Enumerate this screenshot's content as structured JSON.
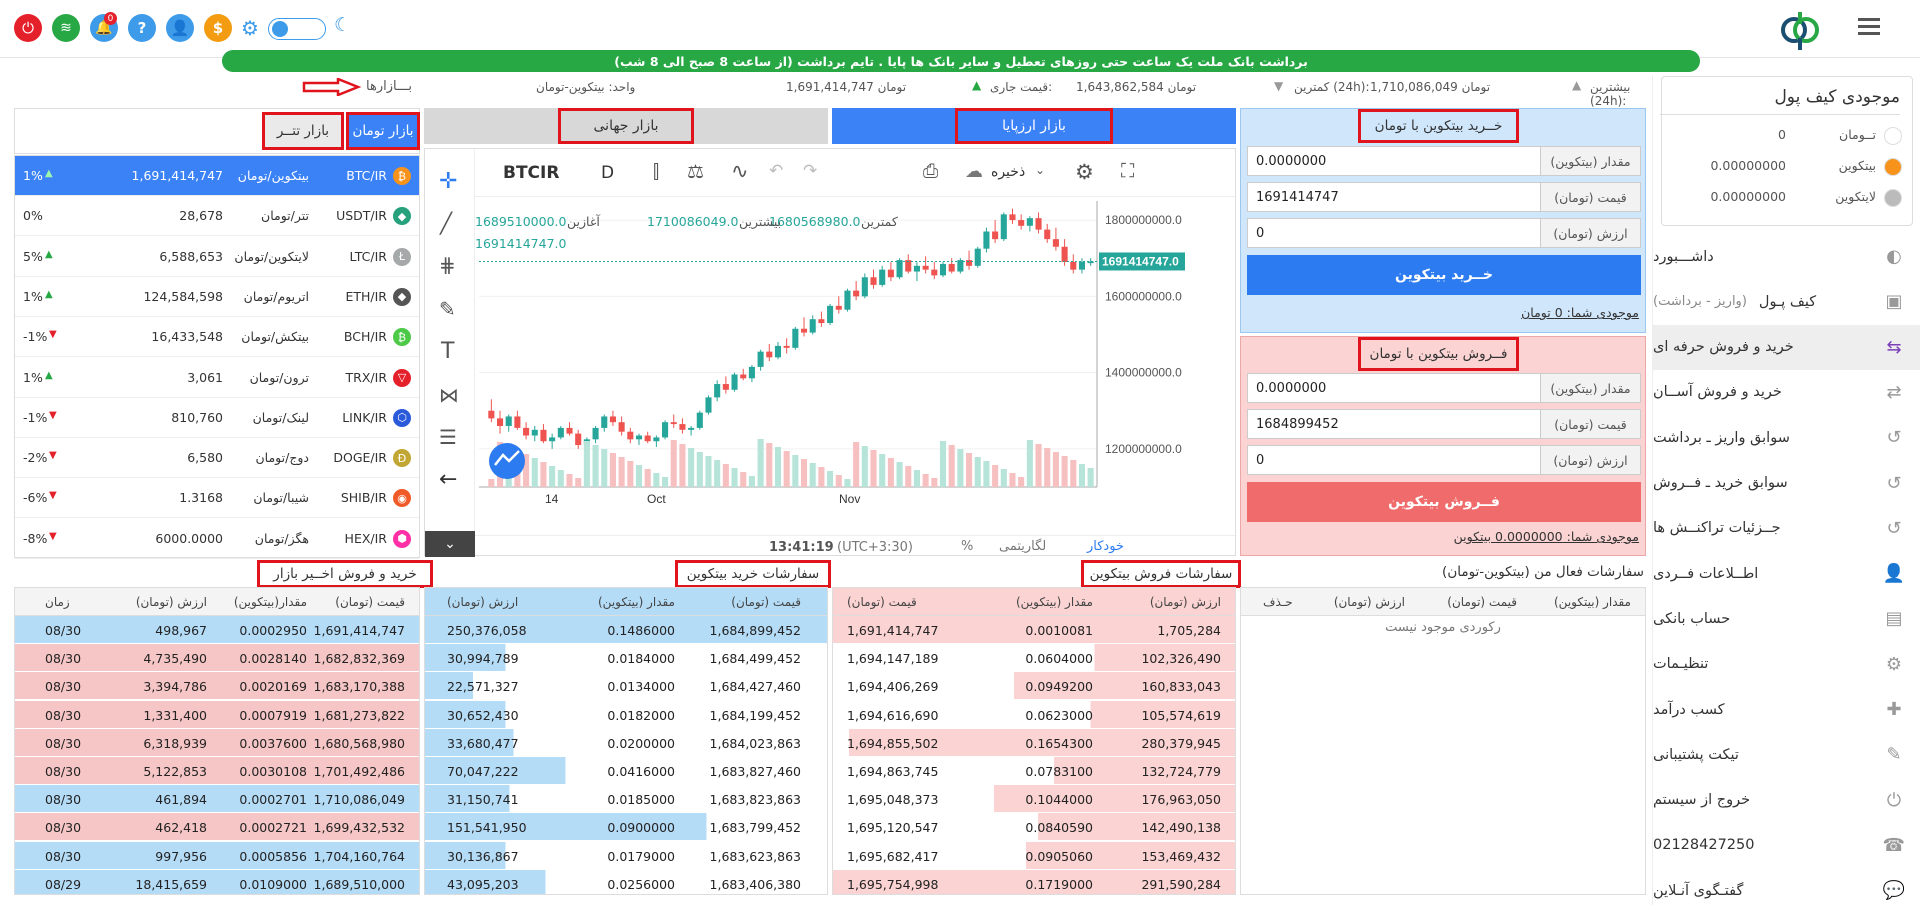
{
  "topbar": {
    "logo": "logo",
    "menu_icon": "menu-icon"
  },
  "banner": {
    "text": "برداشت بانک ملت یک ساعت حتی روزهای تعطیل و سایر بانک ها پایا . تایم برداشت (از ساعت 8 صبح الی 8 شب)"
  },
  "stats": {
    "markets_label": "بـــازارها",
    "unit": "واحد: بیتکوین-تومان",
    "current_label": "قیمت جاری:",
    "current": "1,691,414,747 تومان",
    "low_label": "کمترین (24h):",
    "low": "1,643,862,584 تومان",
    "high_label": "بیشترین (24h):",
    "high": "1,710,086,049 تومان"
  },
  "wallet": {
    "title": "موجودی کیف پول",
    "items": [
      {
        "name": "تــومان",
        "value": "0",
        "color": "#ffffff"
      },
      {
        "name": "بیتکوین",
        "value": "0.00000000",
        "color": "#f7931a"
      },
      {
        "name": "لایتکوین",
        "value": "0.00000000",
        "color": "#bbbbbb"
      }
    ]
  },
  "nav": [
    {
      "label": "داشـــبورد",
      "icon": "dashboard-icon",
      "glyph": "◐"
    },
    {
      "label": "کیف پـول",
      "sub": "(واریز - برداشت)",
      "icon": "wallet-icon",
      "glyph": "▣"
    },
    {
      "label": "خرید و فروش حرفه ای",
      "icon": "trade-pro-icon",
      "glyph": "⇆",
      "active": true
    },
    {
      "label": "خرید و فروش آســان",
      "icon": "trade-easy-icon",
      "glyph": "⇄"
    },
    {
      "label": "سوابق واریز ـ برداشت",
      "icon": "history-icon",
      "glyph": "↺"
    },
    {
      "label": "سوابق خرید ـ فــروش",
      "icon": "history-icon",
      "glyph": "↺"
    },
    {
      "label": "جــزئیات تراکنــش ها",
      "icon": "history-icon",
      "glyph": "↺"
    },
    {
      "label": "اطــلاعات فــردی",
      "icon": "user-icon",
      "glyph": "👤"
    },
    {
      "label": "حساب بانکی",
      "icon": "bank-icon",
      "glyph": "▤"
    },
    {
      "label": "تنظیـمات",
      "icon": "gear-icon",
      "glyph": "⚙"
    },
    {
      "label": "کسب درآمد",
      "icon": "add-user-icon",
      "glyph": "✚"
    },
    {
      "label": "تیکت پشتیبانی",
      "icon": "support-icon",
      "glyph": "✎"
    },
    {
      "label": "خروج از سیستم",
      "icon": "power-icon",
      "glyph": "⏻"
    },
    {
      "label": "02128427250",
      "icon": "headset-icon",
      "glyph": "☎"
    },
    {
      "label": "گفتـگوی آنـلاین",
      "icon": "chat-icon",
      "glyph": "💬"
    }
  ],
  "buy": {
    "title": "خــرید بیتکوین با تومان",
    "amount_label": "مقدار (بیتکوین)",
    "amount": "0.0000000",
    "price_label": "قیمت (تومان)",
    "price": "1691414747",
    "value_label": "ارزش (تومان)",
    "value": "0",
    "button": "خــرید بیتکوین",
    "balance": "موجودی شما: 0 تومان"
  },
  "sell": {
    "title": "فــروش بیتکوین با تومان",
    "amount_label": "مقدار (بیتکوین)",
    "amount": "0.0000000",
    "price_label": "قیمت (تومان)",
    "price": "1684899452",
    "value_label": "ارزش (تومان)",
    "value": "0",
    "button": "فــروش بیتکوین",
    "balance": "موجودی شما: 0.0000000 بیتکوین"
  },
  "market_tabs": {
    "arzpaya": "بازار ارزپایا",
    "global": "بازار جهانی"
  },
  "list_tabs": {
    "toman": "بازار تومان",
    "tether": "بازار تتــر"
  },
  "markets": [
    {
      "symbol": "BTC/IR",
      "name": "بیتکوین/تومان",
      "price": "1,691,414,747",
      "change": "1%",
      "dir": "up",
      "icon": "₿",
      "color": "#f7931a",
      "selected": true
    },
    {
      "symbol": "USDT/IR",
      "name": "تتر/تومان",
      "price": "28,678",
      "change": "0%",
      "dir": "none",
      "icon": "◆",
      "color": "#26a17b"
    },
    {
      "symbol": "LTC/IR",
      "name": "لایتکوین/تومان",
      "price": "6,588,653",
      "change": "5%",
      "dir": "up",
      "icon": "Ł",
      "color": "#a6a9aa"
    },
    {
      "symbol": "ETH/IR",
      "name": "اتریوم/تومان",
      "price": "124,584,598",
      "change": "1%",
      "dir": "up",
      "icon": "◆",
      "color": "#555555"
    },
    {
      "symbol": "BCH/IR",
      "name": "بیتکش/تومان",
      "price": "16,433,548",
      "change": "-1%",
      "dir": "down",
      "icon": "₿",
      "color": "#4cc947"
    },
    {
      "symbol": "TRX/IR",
      "name": "ترون/تومان",
      "price": "3,061",
      "change": "1%",
      "dir": "up",
      "icon": "▽",
      "color": "#e4202a"
    },
    {
      "symbol": "LINK/IR",
      "name": "لینک/تومان",
      "price": "810,760",
      "change": "-1%",
      "dir": "down",
      "icon": "⬡",
      "color": "#2a5ada"
    },
    {
      "symbol": "DOGE/IR",
      "name": "دوج/تومان",
      "price": "6,580",
      "change": "-2%",
      "dir": "down",
      "icon": "Ð",
      "color": "#c2a633"
    },
    {
      "symbol": "SHIB/IR",
      "name": "شیبا/تومان",
      "price": "1.3168",
      "change": "-6%",
      "dir": "down",
      "icon": "◉",
      "color": "#f05a28"
    },
    {
      "symbol": "HEX/IR",
      "name": "هگز/تومان",
      "price": "6000.0000",
      "change": "-8%",
      "dir": "down",
      "icon": "⬢",
      "color": "#ff2fa5"
    }
  ],
  "chart": {
    "symbol": "BTCIR",
    "interval": "D",
    "save": "ذخیره",
    "ohlc": {
      "open_label": "آغازین",
      "open": "1689510000.0",
      "high_label": "بیشترین",
      "high": "1710086049.0",
      "low_label": "کمترین",
      "low": "1680568980.0",
      "close_label": "پایانی",
      "close": "1691414747.0"
    },
    "yticks": [
      "1800000000.0",
      "1600000000.0",
      "1400000000.0",
      "1200000000.0"
    ],
    "xticks": [
      "14",
      "Oct",
      "Nov"
    ],
    "last_price": "1691414747.0",
    "time": "13:41:19",
    "tz": "(UTC+3:30)",
    "pct": "%",
    "log": "لگاریتمی",
    "auto": "خودکار"
  },
  "chart_data": {
    "type": "candlestick",
    "y_range": [
      1100000000,
      1850000000
    ],
    "note": "daily candles",
    "candles": [
      [
        1300,
        1330,
        1270,
        1280
      ],
      [
        1280,
        1300,
        1240,
        1260
      ],
      [
        1260,
        1290,
        1245,
        1285
      ],
      [
        1285,
        1300,
        1250,
        1255
      ],
      [
        1255,
        1270,
        1225,
        1235
      ],
      [
        1235,
        1260,
        1220,
        1250
      ],
      [
        1250,
        1265,
        1215,
        1220
      ],
      [
        1220,
        1240,
        1200,
        1230
      ],
      [
        1230,
        1260,
        1225,
        1255
      ],
      [
        1255,
        1270,
        1235,
        1240
      ],
      [
        1240,
        1250,
        1200,
        1210
      ],
      [
        1210,
        1230,
        1190,
        1225
      ],
      [
        1225,
        1260,
        1215,
        1255
      ],
      [
        1255,
        1290,
        1245,
        1285
      ],
      [
        1285,
        1300,
        1260,
        1270
      ],
      [
        1270,
        1285,
        1235,
        1245
      ],
      [
        1245,
        1255,
        1215,
        1225
      ],
      [
        1225,
        1240,
        1210,
        1235
      ],
      [
        1235,
        1245,
        1215,
        1220
      ],
      [
        1220,
        1235,
        1205,
        1230
      ],
      [
        1230,
        1275,
        1225,
        1270
      ],
      [
        1270,
        1290,
        1255,
        1265
      ],
      [
        1265,
        1280,
        1240,
        1250
      ],
      [
        1250,
        1260,
        1235,
        1255
      ],
      [
        1255,
        1300,
        1250,
        1295
      ],
      [
        1295,
        1340,
        1290,
        1335
      ],
      [
        1335,
        1380,
        1325,
        1370
      ],
      [
        1370,
        1390,
        1345,
        1355
      ],
      [
        1355,
        1400,
        1350,
        1395
      ],
      [
        1395,
        1410,
        1380,
        1385
      ],
      [
        1385,
        1420,
        1375,
        1415
      ],
      [
        1415,
        1460,
        1405,
        1455
      ],
      [
        1455,
        1475,
        1430,
        1440
      ],
      [
        1440,
        1480,
        1435,
        1470
      ],
      [
        1470,
        1490,
        1450,
        1465
      ],
      [
        1465,
        1520,
        1460,
        1515
      ],
      [
        1515,
        1545,
        1495,
        1505
      ],
      [
        1505,
        1550,
        1500,
        1540
      ],
      [
        1540,
        1560,
        1520,
        1530
      ],
      [
        1530,
        1580,
        1525,
        1575
      ],
      [
        1575,
        1600,
        1555,
        1565
      ],
      [
        1565,
        1620,
        1560,
        1615
      ],
      [
        1615,
        1640,
        1590,
        1600
      ],
      [
        1600,
        1660,
        1595,
        1650
      ],
      [
        1650,
        1670,
        1620,
        1630
      ],
      [
        1630,
        1680,
        1625,
        1670
      ],
      [
        1670,
        1690,
        1640,
        1650
      ],
      [
        1650,
        1700,
        1645,
        1695
      ],
      [
        1695,
        1710,
        1660,
        1665
      ],
      [
        1665,
        1690,
        1640,
        1680
      ],
      [
        1680,
        1705,
        1660,
        1670
      ],
      [
        1670,
        1690,
        1645,
        1655
      ],
      [
        1655,
        1690,
        1650,
        1685
      ],
      [
        1685,
        1700,
        1660,
        1665
      ],
      [
        1665,
        1700,
        1660,
        1695
      ],
      [
        1695,
        1720,
        1670,
        1680
      ],
      [
        1680,
        1730,
        1675,
        1725
      ],
      [
        1725,
        1780,
        1715,
        1770
      ],
      [
        1770,
        1800,
        1740,
        1750
      ],
      [
        1750,
        1820,
        1745,
        1815
      ],
      [
        1815,
        1830,
        1790,
        1800
      ],
      [
        1800,
        1815,
        1775,
        1785
      ],
      [
        1785,
        1810,
        1770,
        1805
      ],
      [
        1805,
        1820,
        1765,
        1775
      ],
      [
        1775,
        1790,
        1740,
        1750
      ],
      [
        1750,
        1780,
        1720,
        1730
      ],
      [
        1730,
        1750,
        1680,
        1690
      ],
      [
        1690,
        1710,
        1660,
        1670
      ],
      [
        1670,
        1700,
        1660,
        1690
      ],
      [
        1690,
        1700,
        1680,
        1691
      ]
    ]
  },
  "sell_orders": {
    "title": "سفارشات فروش بیتکوین",
    "headers": [
      "ارزش (تومان)",
      "مقدار (بیتکوین)",
      "قیمت (تومان)"
    ],
    "rows": [
      [
        "1,705,284",
        "0.0010081",
        "1,691,414,747"
      ],
      [
        "102,326,490",
        "0.0604000",
        "1,694,147,189"
      ],
      [
        "160,833,043",
        "0.0949200",
        "1,694,406,269"
      ],
      [
        "105,574,619",
        "0.0623000",
        "1,694,616,690"
      ],
      [
        "280,379,945",
        "0.1654300",
        "1,694,855,502"
      ],
      [
        "132,724,779",
        "0.0783100",
        "1,694,863,745"
      ],
      [
        "176,963,050",
        "0.1044000",
        "1,695,048,373"
      ],
      [
        "142,490,138",
        "0.0840590",
        "1,695,120,547"
      ],
      [
        "153,469,432",
        "0.0905060",
        "1,695,682,417"
      ],
      [
        "291,590,284",
        "0.1719000",
        "1,695,754,998"
      ]
    ]
  },
  "buy_orders": {
    "title": "سفارشات خرید بیتکوین",
    "headers": [
      "قیمت (تومان)",
      "مقدار (بیتکوین)",
      "ارزش (تومان)"
    ],
    "rows": [
      [
        "1,684,899,452",
        "0.1486000",
        "250,376,058"
      ],
      [
        "1,684,499,452",
        "0.0184000",
        "30,994,789"
      ],
      [
        "1,684,427,460",
        "0.0134000",
        "22,571,327"
      ],
      [
        "1,684,199,452",
        "0.0182000",
        "30,652,430"
      ],
      [
        "1,684,023,863",
        "0.0200000",
        "33,680,477"
      ],
      [
        "1,683,827,460",
        "0.0416000",
        "70,047,222"
      ],
      [
        "1,683,823,863",
        "0.0185000",
        "31,150,741"
      ],
      [
        "1,683,799,452",
        "0.0900000",
        "151,541,950"
      ],
      [
        "1,683,623,863",
        "0.0179000",
        "30,136,867"
      ],
      [
        "1,683,406,380",
        "0.0256000",
        "43,095,203"
      ]
    ]
  },
  "recent_trades": {
    "title": "خرید و فروش اخــیر بازار",
    "headers": [
      "قیمت (تومان)",
      "مقدار(بیتکوین)",
      "ارزش (تومان)",
      "زمان"
    ],
    "rows": [
      [
        "1,691,414,747",
        "0.0002950",
        "498,967",
        "08/30",
        "buy"
      ],
      [
        "1,682,832,369",
        "0.0028140",
        "4,735,490",
        "08/30",
        "sell"
      ],
      [
        "1,683,170,388",
        "0.0020169",
        "3,394,786",
        "08/30",
        "sell"
      ],
      [
        "1,681,273,822",
        "0.0007919",
        "1,331,400",
        "08/30",
        "sell"
      ],
      [
        "1,680,568,980",
        "0.0037600",
        "6,318,939",
        "08/30",
        "sell"
      ],
      [
        "1,701,492,486",
        "0.0030108",
        "5,122,853",
        "08/30",
        "sell"
      ],
      [
        "1,710,086,049",
        "0.0002701",
        "461,894",
        "08/30",
        "buy"
      ],
      [
        "1,699,432,532",
        "0.0002721",
        "462,418",
        "08/30",
        "sell"
      ],
      [
        "1,704,160,764",
        "0.0005856",
        "997,956",
        "08/30",
        "buy"
      ],
      [
        "1,689,510,000",
        "0.0109000",
        "18,415,659",
        "08/29",
        "buy"
      ]
    ]
  },
  "my_orders": {
    "title": "سفارشات فعال من (بیتکوین-تومان)",
    "headers": [
      "مقدار (بیتکوین)",
      "قیمت (تومان)",
      "ارزش (تومان)",
      "حـذف"
    ],
    "empty": "رکوردی موجود نیست"
  },
  "colors": {
    "accent": "#3b82f6",
    "green": "#27a844",
    "red": "#e4202a",
    "buy_panel": "#cfe6fb",
    "sell_panel": "#fbd3d3"
  }
}
